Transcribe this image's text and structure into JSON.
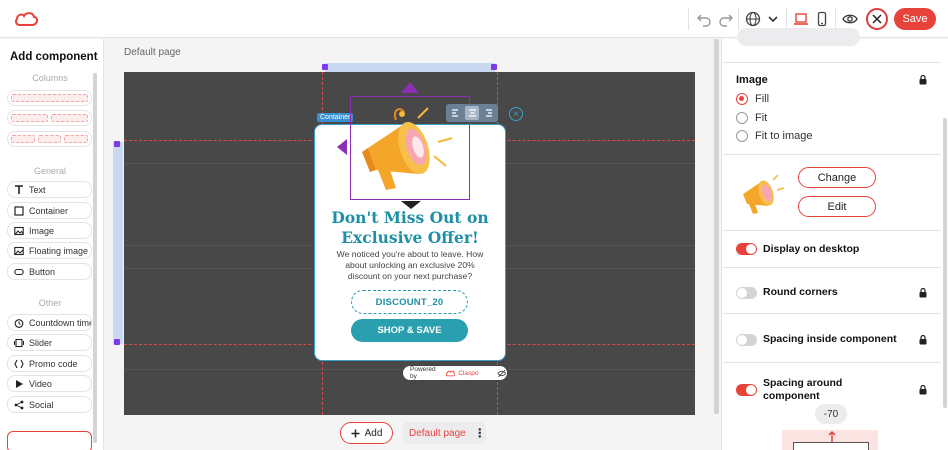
{
  "toolbar": {
    "logo_icon": "claspo-cloud-logo",
    "undo_icon": "undo-icon",
    "redo_icon": "redo-icon",
    "language_icon": "globe-icon",
    "desktop_icon": "laptop-icon",
    "mobile_icon": "phone-icon",
    "preview_icon": "eye-icon",
    "close_icon": "close-icon",
    "save_label": "Save",
    "accent_color": "#e8433a"
  },
  "sidebar": {
    "title": "Add component",
    "sections": {
      "columns": "Columns",
      "general": "General",
      "other": "Other"
    },
    "general_items": [
      {
        "label": "Text",
        "icon": "text-icon"
      },
      {
        "label": "Container",
        "icon": "square-icon"
      },
      {
        "label": "Image",
        "icon": "image-icon"
      },
      {
        "label": "Floating image",
        "icon": "floating-image-icon"
      },
      {
        "label": "Button",
        "icon": "button-icon"
      }
    ],
    "other_items": [
      {
        "label": "Countdown timer",
        "icon": "timer-icon"
      },
      {
        "label": "Slider",
        "icon": "slider-icon"
      },
      {
        "label": "Promo code",
        "icon": "promo-code-icon"
      },
      {
        "label": "Video",
        "icon": "play-icon"
      },
      {
        "label": "Social",
        "icon": "share-icon"
      }
    ]
  },
  "canvas": {
    "page_label": "Default page",
    "container_tag": "Container",
    "popup": {
      "title_line1": "Don't Miss Out on",
      "title_line2": "Exclusive Offer!",
      "body": "We noticed you're about to leave. How about unlocking an exclusive 20% discount on your next purchase?",
      "coupon_code": "DISCOUNT_20",
      "cta_label": "SHOP & SAVE",
      "powered_by": "Powered by",
      "brand": "Claspo",
      "accent_color": "#1d8fa6",
      "image_icon": "megaphone-icon"
    },
    "add_label": "Add",
    "page_chip": "Default page"
  },
  "right_panel": {
    "image_heading": "Image",
    "image_options": [
      {
        "label": "Fill",
        "selected": true
      },
      {
        "label": "Fit",
        "selected": false
      },
      {
        "label": "Fit to image",
        "selected": false
      }
    ],
    "change_label": "Change",
    "edit_label": "Edit",
    "toggles": [
      {
        "label": "Display on desktop",
        "on": true,
        "locked": false
      },
      {
        "label": "Round corners",
        "on": false,
        "locked": true
      },
      {
        "label": "Spacing inside component",
        "on": false,
        "locked": true
      },
      {
        "label": "Spacing around component",
        "on": true,
        "locked": true
      }
    ],
    "spacing_value": "-70"
  }
}
